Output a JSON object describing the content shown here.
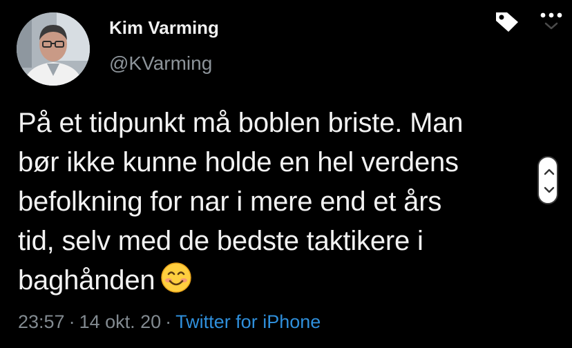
{
  "author": {
    "name": "Kim Varming",
    "handle": "@KVarming"
  },
  "tweet": {
    "lines": [
      "På et tidpunkt må boblen briste. Man",
      "bør ikke kunne holde en hel verdens",
      "befolkning for nar i mere end et års",
      "tid, selv med de bedste taktikere i",
      "baghånden"
    ],
    "emoji": "smiling-face-emoji"
  },
  "meta": {
    "time": "23:57",
    "date": "14 okt. 20",
    "separator": "·",
    "source": "Twitter for iPhone"
  },
  "icons": {
    "tag": "tag-icon",
    "more": "more-dots-icon",
    "scroll": "scroll-up-down-icon"
  },
  "colors": {
    "background": "#000000",
    "text": "#f2f2f2",
    "muted": "#828a90",
    "link": "#2f8fdb"
  }
}
